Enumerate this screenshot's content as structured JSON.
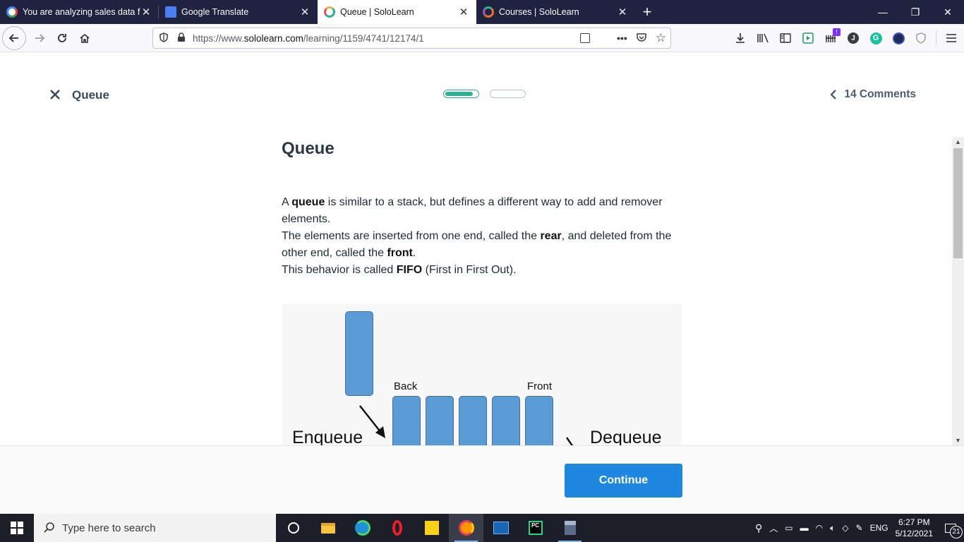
{
  "browser": {
    "tabs": [
      {
        "title": "You are analyzing sales data fro",
        "favicon_color": "#4285f4",
        "active": false
      },
      {
        "title": "Google Translate",
        "favicon_color": "#4a7ff0",
        "active": false
      },
      {
        "title": "Queue | SoloLearn",
        "favicon_color": "#2bb295",
        "active": true
      },
      {
        "title": "Courses | SoloLearn",
        "favicon_color": "#ee6c2e",
        "active": false
      }
    ],
    "url": {
      "prefix": "https://www.",
      "domain": "sololearn.com",
      "path": "/learning/1159/4741/12174/1"
    }
  },
  "lesson": {
    "name": "Queue",
    "comments": "14 Comments",
    "progress": {
      "total": 2,
      "current": 1,
      "fill_fraction": 0.8
    },
    "title": "Queue",
    "paragraph": [
      [
        {
          "t": "A "
        },
        {
          "t": "queue",
          "b": true
        },
        {
          "t": " is similar to a stack, but defines a different way to add and remover elements."
        }
      ],
      [
        {
          "t": "The elements are inserted from one end, called the "
        },
        {
          "t": "rear",
          "b": true
        },
        {
          "t": ", and deleted from the other end, called the "
        },
        {
          "t": "front",
          "b": true
        },
        {
          "t": "."
        }
      ],
      [
        {
          "t": "This behavior is called "
        },
        {
          "t": "FIFO",
          "b": true
        },
        {
          "t": " (First in First Out)."
        }
      ]
    ],
    "diagram": {
      "back_label": "Back",
      "front_label": "Front",
      "enqueue_label": "Enqueue",
      "dequeue_label": "Dequeue"
    },
    "continue_label": "Continue"
  },
  "taskbar": {
    "search_placeholder": "Type here to search",
    "language": "ENG",
    "time": "6:27 PM",
    "date": "5/12/2021",
    "notifications": "21"
  },
  "colors": {
    "accent": "#1e87e0",
    "progress": "#2bb295",
    "block": "#5b9bd5"
  }
}
